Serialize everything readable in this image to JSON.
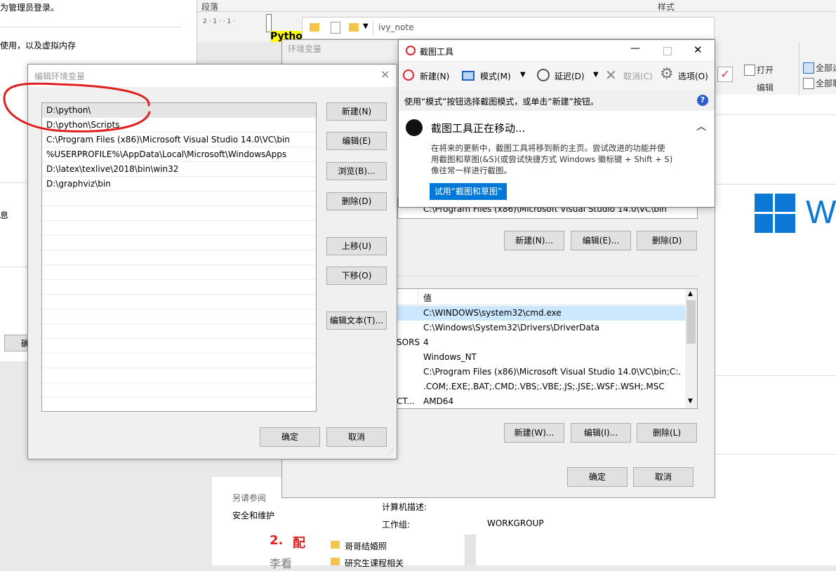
{
  "background_left": {
    "line1": "为管理员登录。",
    "line2": "使用，以及虚拟内存",
    "line3": "息",
    "btn_partial": "确"
  },
  "word_ribbon": {
    "paragraph_group": "段落",
    "styles_group": "样式",
    "ruler_text": "2 · 1 · · 1 ·",
    "highlight_text": "Pytho",
    "open_label": "打开",
    "edit_label": "编辑",
    "select_all_1": "全部选",
    "select_all_2": "全部取"
  },
  "explorer_bar": {
    "folder_name": "ivy_note"
  },
  "win_logo_letter": "W",
  "env_vars_window": {
    "title": "环境变量",
    "user_path_value": "C:\\Program Files (x86)\\Microsoft Visual Studio 14.0\\VC\\bin",
    "user_buttons": [
      "新建(N)...",
      "编辑(E)...",
      "删除(D)"
    ],
    "sys_header_var": "",
    "sys_header_val": "值",
    "sys_rows": [
      {
        "name": "",
        "value": "C:\\WINDOWS\\system32\\cmd.exe"
      },
      {
        "name": "",
        "value": "C:\\Windows\\System32\\Drivers\\DriverData"
      },
      {
        "name": "SORS",
        "value": "4"
      },
      {
        "name": "",
        "value": "Windows_NT"
      },
      {
        "name": "",
        "value": "C:\\Program Files (x86)\\Microsoft Visual Studio 14.0\\VC\\bin;C:..."
      },
      {
        "name": "",
        "value": ".COM;.EXE;.BAT;.CMD;.VBS;.VBE;.JS;.JSE;.WSF;.WSH;.MSC"
      },
      {
        "name": "CT...",
        "value": "AMD64"
      }
    ],
    "sys_buttons": [
      "新建(W)...",
      "编辑(I)...",
      "删除(L)"
    ],
    "ok": "确定",
    "cancel": "取消"
  },
  "edit_env_dialog": {
    "title": "编辑环境变量",
    "entries": [
      "D:\\python\\",
      "D:\\python\\Scripts",
      "C:\\Program Files (x86)\\Microsoft Visual Studio 14.0\\VC\\bin",
      "%USERPROFILE%\\AppData\\Local\\Microsoft\\WindowsApps",
      "D:\\latex\\texlive\\2018\\bin\\win32",
      "D:\\graphviz\\bin"
    ],
    "buttons": {
      "new": "新建(N)",
      "edit": "编辑(E)",
      "browse": "浏览(B)...",
      "delete": "删除(D)",
      "move_up": "上移(U)",
      "move_down": "下移(O)",
      "edit_text": "编辑文本(T)..."
    },
    "ok": "确定",
    "cancel": "取消"
  },
  "system_page": {
    "see_also": "另请参阅",
    "security": "安全和维护",
    "computer_desc_label": "计算机描述:",
    "workgroup_label": "工作组:",
    "workgroup_value": "WORKGROUP"
  },
  "bottom_doc": {
    "heading_num": "2.",
    "heading_partial": "配",
    "partial_text": "李看",
    "folder1": "哥哥结婚照",
    "folder2": "研究生课程相关"
  },
  "snipping_tool": {
    "title": "截图工具",
    "toolbar": {
      "new": "新建(N)",
      "mode": "模式(M)",
      "delay": "延迟(D)",
      "cancel": "取消(C)",
      "options": "选项(O)"
    },
    "hint": "使用“模式”按钮选择截图模式，或单击“新建”按钮。",
    "notice_title": "截图工具正在移动...",
    "notice_body": [
      "在将来的更新中，截图工具将移到新的主页。尝试改进的功能并使",
      "用截图和草图(&S)(或尝试快捷方式 Windows 徽标键 + Shift + S)",
      "像往常一样进行截图。"
    ],
    "try_button": "试用“截图和草图”"
  },
  "colors": {
    "accent_blue": "#0078d7",
    "annotation_red": "#e0201c",
    "win_logo_blue": "#0a78d4"
  }
}
